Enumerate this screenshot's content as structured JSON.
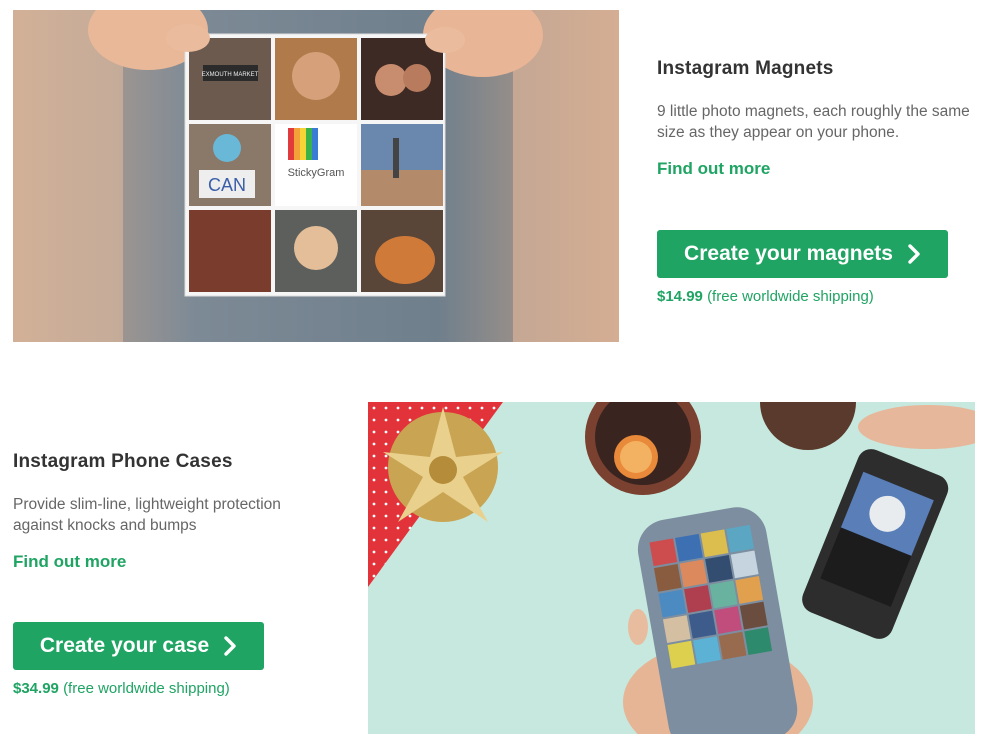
{
  "products": [
    {
      "title": "Instagram Magnets",
      "description": "9 little photo magnets, each roughly the same size as they appear on your phone.",
      "link_label": "Find out more",
      "cta_label": "Create your magnets",
      "price": "$14.99",
      "shipping": "(free worldwide shipping)",
      "image": {
        "brand_label": "StickyGram",
        "sign_label": "CAN",
        "street_sign": "EXMOUTH MARKET"
      }
    },
    {
      "title": "Instagram Phone Cases",
      "description": "Provide slim-line, lightweight protection against knocks and bumps",
      "link_label": "Find out more",
      "cta_label": "Create your case",
      "price": "$34.99",
      "shipping": "(free worldwide shipping)"
    }
  ],
  "colors": {
    "accent": "#1fa463",
    "title": "#333333",
    "body_text": "#666666"
  },
  "icons": {
    "cta_chevron": "chevron-right-icon"
  }
}
